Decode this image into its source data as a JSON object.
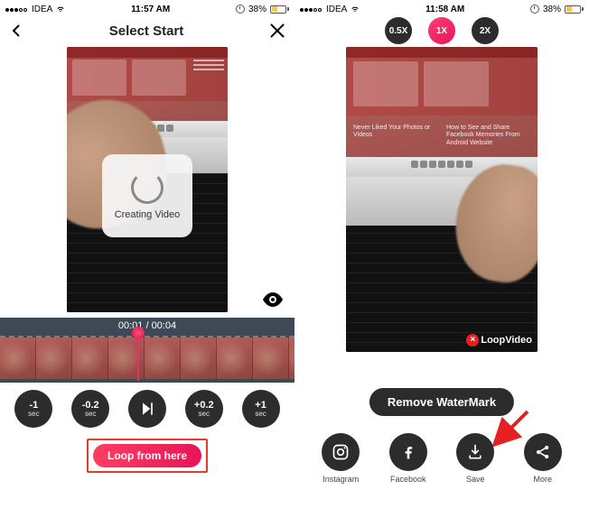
{
  "left": {
    "status": {
      "carrier": "IDEA",
      "time": "11:57 AM",
      "battery": "38%"
    },
    "header": {
      "title": "Select Start"
    },
    "loading": {
      "label": "Creating Video"
    },
    "timeline": {
      "time": "00:01 / 00:04"
    },
    "steps": {
      "back1": {
        "num": "-1",
        "unit": "sec"
      },
      "back02": {
        "num": "-0.2",
        "unit": "sec"
      },
      "fwd02": {
        "num": "+0.2",
        "unit": "sec"
      },
      "fwd1": {
        "num": "+1",
        "unit": "sec"
      }
    },
    "loop_button": "Loop from here"
  },
  "right": {
    "status": {
      "carrier": "IDEA",
      "time": "11:58 AM",
      "battery": "38%"
    },
    "speed": {
      "half": "0.5X",
      "one": "1X",
      "two": "2X"
    },
    "preview": {
      "caption_a": "Never Liked Your Photos or Videos",
      "caption_b": "How to See and Share Facebook Memories From Android Website"
    },
    "watermark": {
      "x": "×",
      "label": "LoopVideo"
    },
    "remove": "Remove WaterMark",
    "share": {
      "instagram": "Instagram",
      "facebook": "Facebook",
      "save": "Save",
      "more": "More"
    }
  }
}
